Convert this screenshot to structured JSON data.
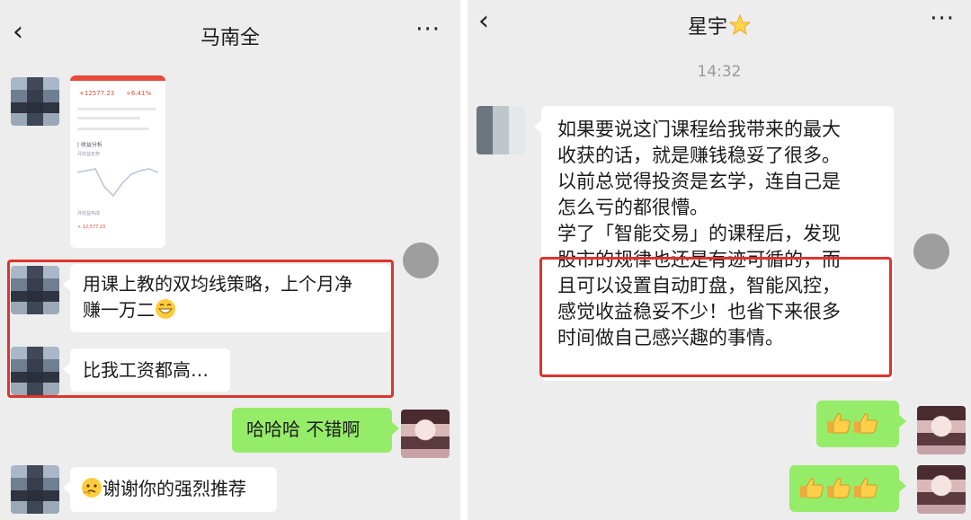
{
  "left_chat": {
    "back_glyph": "‹",
    "title": "马南全",
    "more_glyph": "···",
    "screenshot_card": {
      "value_left": "+12577.23",
      "value_right": "+6.41%",
      "section_label": "| 收益分析",
      "chart_label": "月收益走势",
      "table_label": "月收益构成",
      "table_value": "+ 12,577.23"
    },
    "messages": [
      {
        "from": "other",
        "text_line1": "用课上教的双均线策略，上个月净",
        "text_line2": "赚一万二"
      },
      {
        "from": "other",
        "text": "比我工资都高…"
      },
      {
        "from": "me",
        "text": "哈哈哈 不错啊"
      },
      {
        "from": "other",
        "text": "谢谢你的强烈推荐"
      }
    ]
  },
  "right_chat": {
    "back_glyph": "‹",
    "title": "星宇",
    "more_glyph": "···",
    "time": "14:32",
    "long_message_lines": [
      "如果要说这门课程给我带来的最大",
      "收获的话，就是赚钱稳妥了很多。",
      "以前总觉得投资是玄学，连自己是",
      "怎么亏的都很懵。",
      "学了「智能交易」的课程后，发现",
      "股市的规律也还是有迹可循的，而",
      "且可以设置自动盯盘，智能风控，",
      "感觉收益稳妥不少！也省下来很多",
      "时间做自己感兴趣的事情。"
    ],
    "reply_thumbs_1": 2,
    "reply_thumbs_2": 3
  },
  "colors": {
    "background": "#ededed",
    "bubble_white": "#ffffff",
    "bubble_green": "#95ec69",
    "highlight_red": "#e0332d"
  },
  "icons": [
    "back-arrow-icon",
    "more-icon",
    "star-icon",
    "grin-emoji-icon",
    "thinking-emoji-icon",
    "thumbs-up-icon"
  ]
}
